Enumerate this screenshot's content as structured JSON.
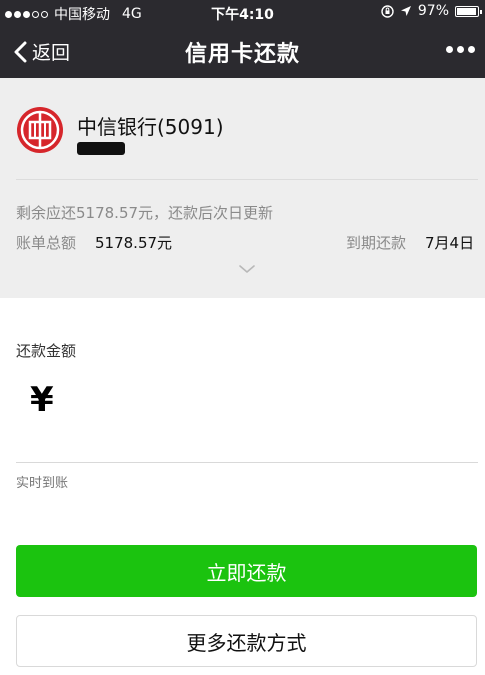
{
  "status_bar": {
    "carrier": "中国移动",
    "network": "4G",
    "time": "下午4:10",
    "battery": "97%",
    "battery_level": 0.97
  },
  "nav": {
    "back_label": "返回",
    "title": "信用卡还款"
  },
  "card": {
    "bank_name": "中信银行(5091)",
    "remaining_text": "剩余应还5178.57元，还款后次日更新",
    "bill_total_label": "账单总额",
    "bill_total_value": "5178.57元",
    "due_label": "到期还款",
    "due_value": "7月4日"
  },
  "payment": {
    "amount_label": "还款金额",
    "currency_symbol": "¥",
    "amount_value": "",
    "arrival_note": "实时到账"
  },
  "buttons": {
    "pay_now": "立即还款",
    "more_methods": "更多还款方式"
  },
  "colors": {
    "accent": "#1bc30f",
    "header_bg": "#2b2a2f",
    "bank_logo": "#d6262b"
  }
}
